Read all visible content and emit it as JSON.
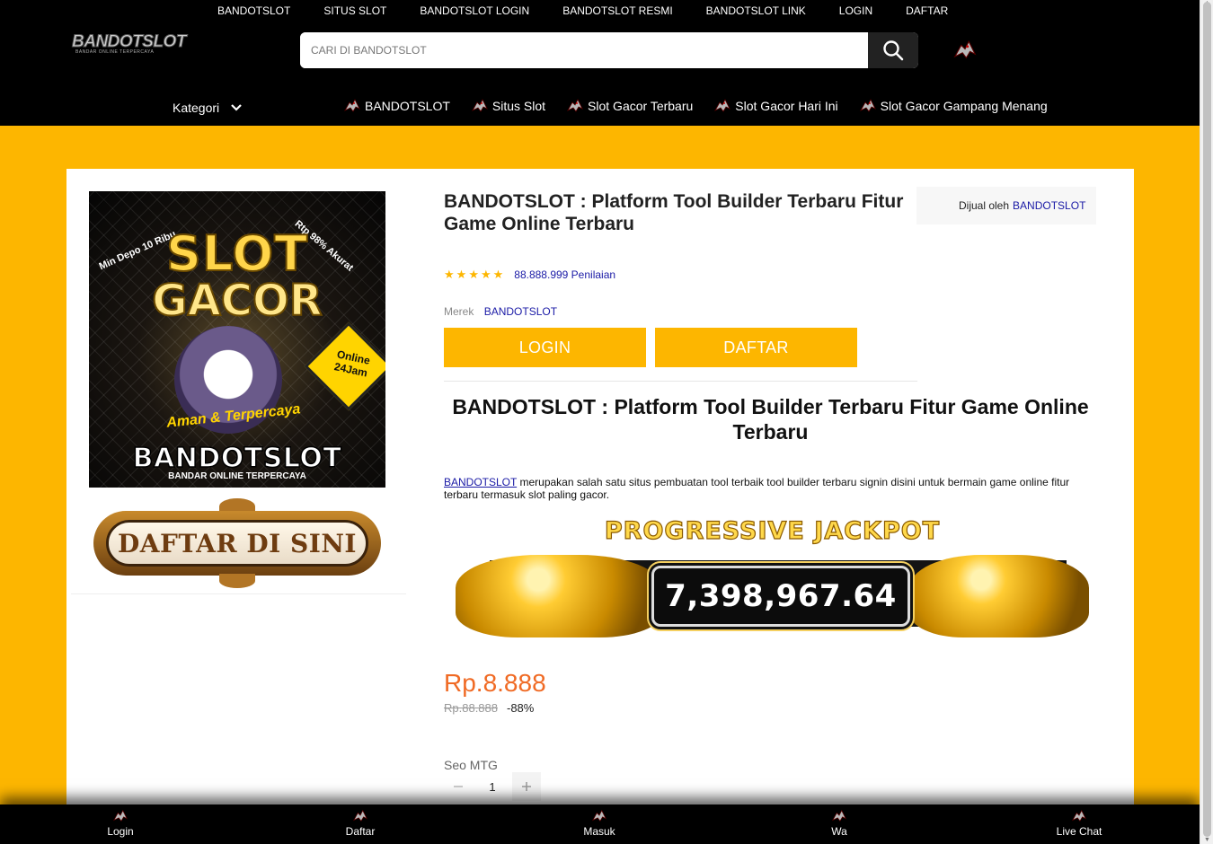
{
  "topnav": [
    "BANDOTSLOT",
    "SITUS SLOT",
    "BANDOTSLOT LOGIN",
    "BANDOTSLOT RESMI",
    "BANDOTSLOT LINK",
    "LOGIN",
    "DAFTAR"
  ],
  "logo": {
    "word": "BANDOTSLOT",
    "tagline": "BANDAR ONLINE TERPERCAYA"
  },
  "search": {
    "placeholder": "CARI DI BANDOTSLOT"
  },
  "category": {
    "label": "Kategori",
    "items": [
      "BANDOTSLOT",
      "Situs Slot",
      "Slot Gacor Terbaru",
      "Slot Gacor Hari Ini",
      "Slot Gacor Gampang Menang"
    ]
  },
  "hero": {
    "line1": "SLOT",
    "line2": "GACOR",
    "min_depo": "Min Depo 10 Ribu",
    "rtp": "Rtp 98% Akurat",
    "online": "Online 24Jam",
    "aman": "Aman & Terpercaya",
    "brand": "BANDOTSLOT",
    "brand_sub": "BANDAR ONLINE TERPERCAYA"
  },
  "daftar_banner": "DAFTAR DI SINI",
  "product": {
    "title": "BANDOTSLOT : Platform Tool Builder Terbaru Fitur Game Online Terbaru",
    "seller_prefix": "Dijual oleh",
    "seller": "BANDOTSLOT",
    "rating_stars": 5,
    "rating_count": "88.888.999 Penilaian",
    "merek_label": "Merek",
    "merek": "BANDOTSLOT",
    "login_button": "LOGIN",
    "daftar_button": "DAFTAR",
    "heading": "BANDOTSLOT : Platform Tool Builder Terbaru Fitur Game Online Terbaru",
    "desc_link": "BANDOTSLOT",
    "desc_text": " merupakan salah satu situs pembuatan tool terbaik tool builder terbaru signin disini untuk bermain game online fitur terbaru termasuk slot paling gacor.",
    "jackpot_title": "PROGRESSIVE JACKPOT",
    "jackpot_value": "7,398,967.64",
    "price": "Rp.8.888",
    "old_price": "Rp.88.888",
    "discount": "-88%",
    "variant_label": "Seo MTG",
    "quantity": "1"
  },
  "bottombar": [
    "Login",
    "Daftar",
    "Masuk",
    "Wa",
    "Live Chat"
  ],
  "colors": {
    "header_bg": "#000000",
    "page_bg": "#fdb600",
    "button_bg": "#fdb600",
    "price": "#f06a24",
    "link": "#1a1aa6"
  }
}
